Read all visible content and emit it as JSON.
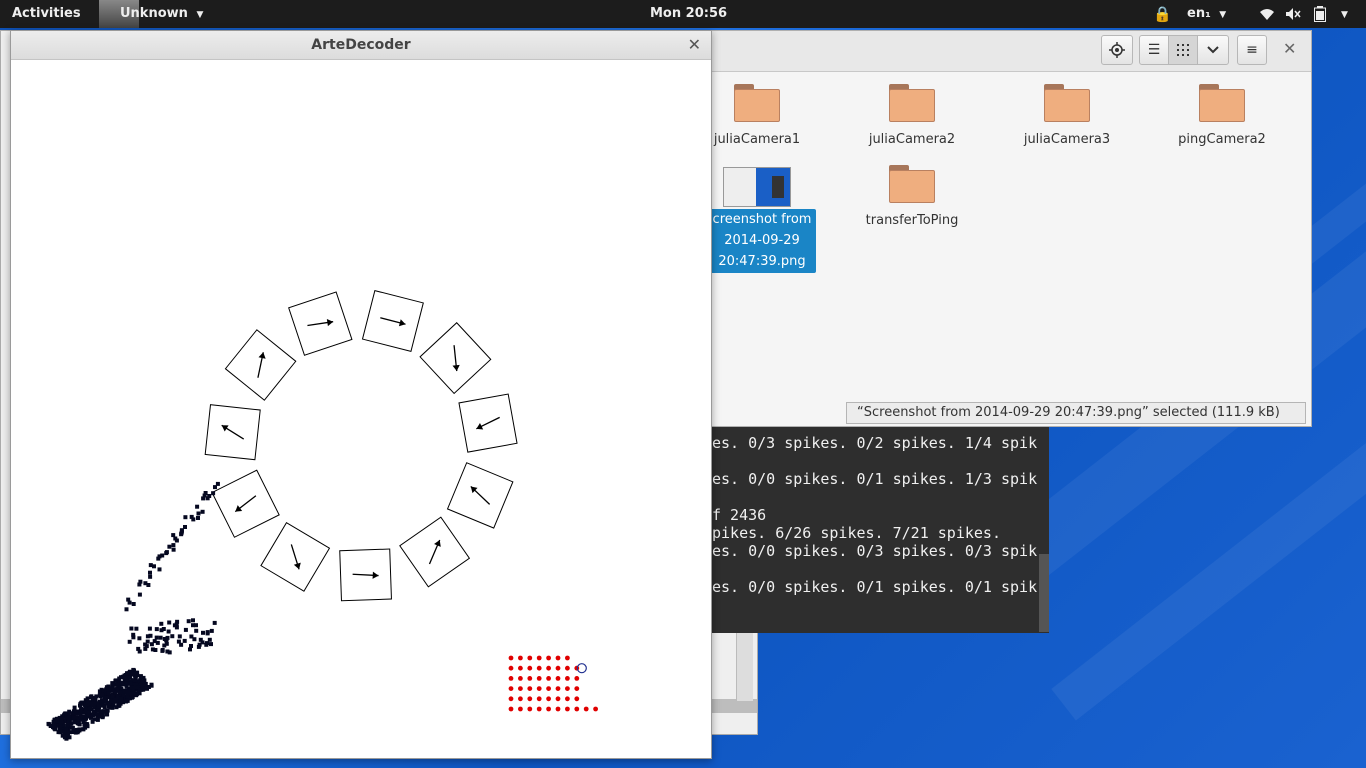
{
  "topbar": {
    "activities": "Activities",
    "app_menu": "Unknown",
    "clock": "Mon 20:56",
    "language": "en₁"
  },
  "files_window": {
    "items": [
      {
        "label": "juliaCamera1",
        "type": "folder"
      },
      {
        "label": "juliaCamera2",
        "type": "folder"
      },
      {
        "label": "juliaCamera3",
        "type": "folder"
      },
      {
        "label": "pingCamera2",
        "type": "folder"
      },
      {
        "label": "creenshot from\n2014-09-29\n20:47:39.png",
        "type": "image",
        "selected": true
      },
      {
        "label": "transferToPing",
        "type": "folder"
      }
    ],
    "status": "“Screenshot from 2014-09-29 20:47:39.png” selected  (111.9 kB)"
  },
  "terminal": {
    "lines": [
      "es. 0/3 spikes. 0/2 spikes. 1/4 spik",
      "",
      "es. 0/0 spikes. 0/1 spikes. 1/3 spik",
      "",
      "f 2436",
      "pikes. 6/26 spikes. 7/21 spikes.",
      "es. 0/0 spikes. 0/3 spikes. 0/3 spik",
      "",
      "es. 0/0 spikes. 0/1 spikes. 0/1 spik"
    ]
  },
  "arte_window": {
    "title": "ArteDecoder"
  },
  "colors": {
    "accent": "#1a85c6",
    "dots": "#e00000"
  }
}
